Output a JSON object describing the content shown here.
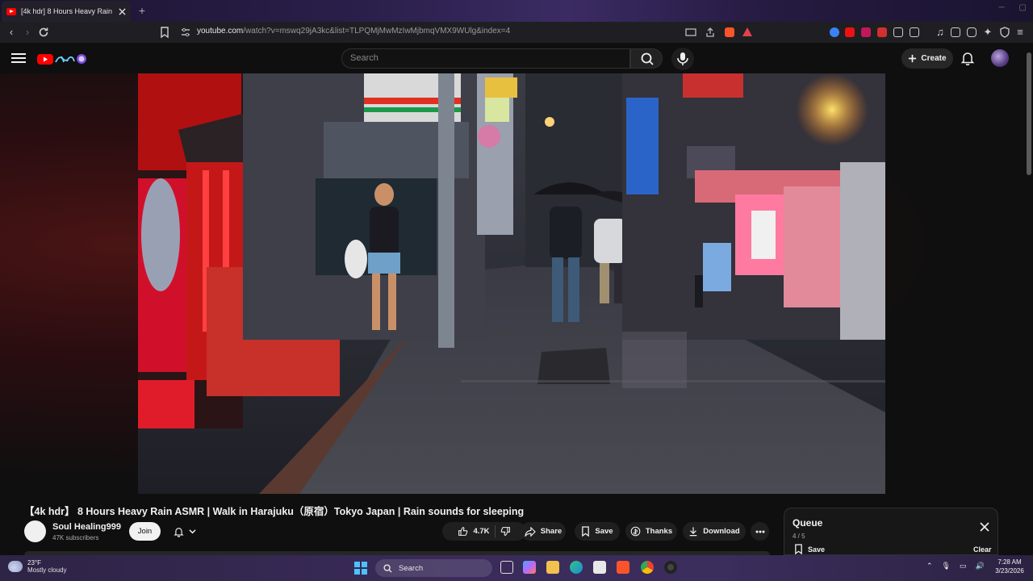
{
  "browser": {
    "tab_title": "[4k hdr] 8 Hours Heavy Rain",
    "new_tab_label": "+",
    "url_host": "youtube.com",
    "url_path": "/watch?v=mswq29jA3kc&list=TLPQMjMwMzIwMjbmqVMX9WUlg&index=4"
  },
  "masthead": {
    "search_placeholder": "Search",
    "create_label": "Create"
  },
  "video": {
    "title": "【4k hdr】 8 Hours Heavy Rain ASMR | Walk in Harajuku（原宿）Tokyo Japan | Rain sounds for sleeping",
    "channel_name": "Soul Healing999",
    "subscribers": "47K subscribers",
    "join_label": "Join",
    "likes": "4.7K",
    "share_label": "Share",
    "save_label": "Save",
    "thanks_label": "Thanks",
    "download_label": "Download"
  },
  "queue": {
    "title": "Queue",
    "count": "4 / 5",
    "save_label": "Save",
    "clear_label": "Clear"
  },
  "taskbar": {
    "weather_temp": "23°F",
    "weather_desc": "Mostly cloudy",
    "search_label": "Search",
    "time": "7:28 AM",
    "date": "3/23/2026"
  },
  "colors": {
    "youtube_red": "#ff0000",
    "background": "#0f0f0f",
    "pill": "#1f1f1f",
    "windows_accent": "#4cc2ff"
  }
}
